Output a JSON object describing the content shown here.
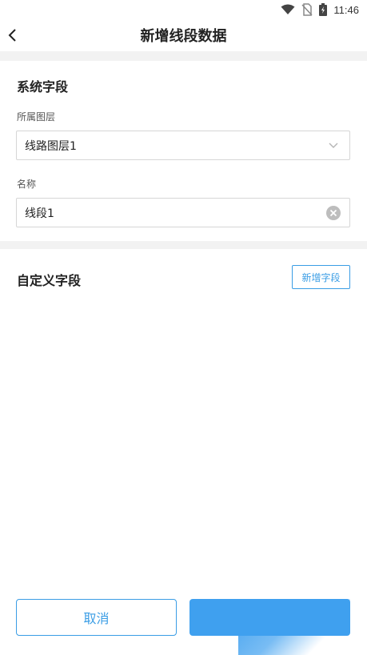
{
  "status_bar": {
    "time": "11:46"
  },
  "header": {
    "title": "新增线段数据"
  },
  "system_fields": {
    "title": "系统字段",
    "layer_label": "所属图层",
    "layer_value": "线路图层1",
    "name_label": "名称",
    "name_value": "线段1"
  },
  "custom_fields": {
    "title": "自定义字段",
    "add_button": "新增字段"
  },
  "footer": {
    "cancel_label": "取消",
    "confirm_label": ""
  },
  "colors": {
    "accent": "#3a9de5",
    "section_gap": "#f2f2f2"
  }
}
